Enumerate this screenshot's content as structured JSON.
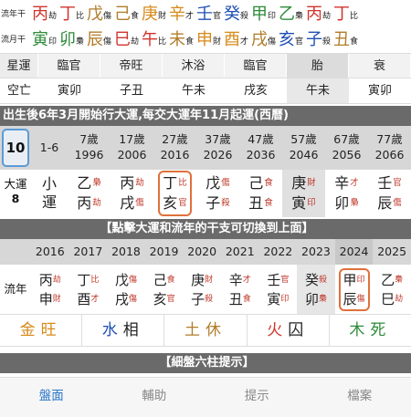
{
  "liunian_gz_row": {
    "label_top": "流年干",
    "label_bottom": "流月干",
    "pairs": [
      {
        "ch": "丙",
        "god": "劫",
        "color": "#d0342c"
      },
      {
        "ch": "丁",
        "god": "比",
        "color": "#d0342c"
      },
      {
        "ch": "戊",
        "god": "傷",
        "color": "#b07d2a"
      },
      {
        "ch": "己",
        "god": "食",
        "color": "#b07d2a"
      },
      {
        "ch": "庚",
        "god": "財",
        "color": "#d68a1a"
      },
      {
        "ch": "辛",
        "god": "才",
        "color": "#d68a1a"
      },
      {
        "ch": "壬",
        "god": "官",
        "color": "#1f4fb3"
      },
      {
        "ch": "癸",
        "god": "殺",
        "color": "#1f4fb3"
      },
      {
        "ch": "甲",
        "god": "印",
        "color": "#2e8b3a"
      },
      {
        "ch": "乙",
        "god": "梟",
        "color": "#2e8b3a"
      },
      {
        "ch": "丙",
        "god": "劫",
        "color": "#d0342c"
      },
      {
        "ch": "丁",
        "god": "比",
        "color": "#d0342c"
      }
    ]
  },
  "liuyue_gz_row": {
    "pairs": [
      {
        "ch": "寅",
        "god": "印",
        "color": "#2e8b3a"
      },
      {
        "ch": "卯",
        "god": "梟",
        "color": "#2e8b3a"
      },
      {
        "ch": "辰",
        "god": "傷",
        "color": "#b07d2a"
      },
      {
        "ch": "巳",
        "god": "劫",
        "color": "#d0342c"
      },
      {
        "ch": "午",
        "god": "比",
        "color": "#d0342c"
      },
      {
        "ch": "未",
        "god": "食",
        "color": "#b07d2a"
      },
      {
        "ch": "申",
        "god": "財",
        "color": "#d68a1a"
      },
      {
        "ch": "酉",
        "god": "才",
        "color": "#d68a1a"
      },
      {
        "ch": "戌",
        "god": "傷",
        "color": "#b07d2a"
      },
      {
        "ch": "亥",
        "god": "官",
        "color": "#1f4fb3"
      },
      {
        "ch": "子",
        "god": "殺",
        "color": "#1f4fb3"
      },
      {
        "ch": "丑",
        "god": "食",
        "color": "#b07d2a"
      }
    ]
  },
  "star_row": {
    "label": "星運",
    "cells": [
      "臨官",
      "帝旺",
      "沐浴",
      "臨官",
      "胎",
      "衰"
    ]
  },
  "kong_row": {
    "label": "空亡",
    "cells": [
      "寅卯",
      "子丑",
      "午未",
      "戌亥",
      "午未",
      "寅卯"
    ]
  },
  "dayun_banner": "出生後6年3月開始行大運,每交大運年11月起運(西曆)",
  "dayun": {
    "selected_number": "10",
    "first_age": "1-6",
    "label_top": "大運",
    "label_bottom": "8",
    "xiao_top": "小",
    "xiao_bottom": "運",
    "columns": [
      {
        "age": "7歲",
        "year": "1996",
        "gan": "乙",
        "gan_god": "梟",
        "zhi": "丙",
        "zhi_god": "劫"
      },
      {
        "age": "17歲",
        "year": "2006",
        "gan": "丙",
        "gan_god": "劫",
        "zhi": "戌",
        "zhi_god": "傷"
      },
      {
        "age": "27歲",
        "year": "2016",
        "gan": "丁",
        "gan_god": "比",
        "zhi": "亥",
        "zhi_god": "官"
      },
      {
        "age": "37歲",
        "year": "2026",
        "gan": "戊",
        "gan_god": "傷",
        "zhi": "子",
        "zhi_god": "殺"
      },
      {
        "age": "47歲",
        "year": "2036",
        "gan": "己",
        "gan_god": "食",
        "zhi": "丑",
        "zhi_god": "食"
      },
      {
        "age": "57歲",
        "year": "2046",
        "gan": "庚",
        "gan_god": "財",
        "zhi": "寅",
        "zhi_god": "印"
      },
      {
        "age": "67歲",
        "year": "2056",
        "gan": "辛",
        "gan_god": "才",
        "zhi": "卯",
        "zhi_god": "梟"
      },
      {
        "age": "77歲",
        "year": "2066",
        "gan": "壬",
        "gan_god": "官",
        "zhi": "辰",
        "zhi_god": "傷"
      }
    ]
  },
  "click_banner": "【點擊大運和流年的干支可切換到上面】",
  "liunian": {
    "label": "流年",
    "columns": [
      {
        "year": "2016",
        "gan": "丙",
        "gan_god": "劫",
        "zhi": "申",
        "zhi_god": "財"
      },
      {
        "year": "2017",
        "gan": "丁",
        "gan_god": "比",
        "zhi": "酉",
        "zhi_god": "才"
      },
      {
        "year": "2018",
        "gan": "戊",
        "gan_god": "傷",
        "zhi": "戌",
        "zhi_god": "傷"
      },
      {
        "year": "2019",
        "gan": "己",
        "gan_god": "食",
        "zhi": "亥",
        "zhi_god": "官"
      },
      {
        "year": "2020",
        "gan": "庚",
        "gan_god": "財",
        "zhi": "子",
        "zhi_god": "殺"
      },
      {
        "year": "2021",
        "gan": "辛",
        "gan_god": "才",
        "zhi": "丑",
        "zhi_god": "食"
      },
      {
        "year": "2022",
        "gan": "壬",
        "gan_god": "官",
        "zhi": "寅",
        "zhi_god": "印"
      },
      {
        "year": "2023",
        "gan": "癸",
        "gan_god": "殺",
        "zhi": "卯",
        "zhi_god": "梟"
      },
      {
        "year": "2024",
        "gan": "甲",
        "gan_god": "印",
        "zhi": "辰",
        "zhi_god": "傷"
      },
      {
        "year": "2025",
        "gan": "乙",
        "gan_god": "梟",
        "zhi": "巳",
        "zhi_god": "劫"
      }
    ]
  },
  "wuxing": [
    {
      "element": "金",
      "state": "旺",
      "color": "#d68a1a"
    },
    {
      "element": "水",
      "state": "相",
      "color": "#1f4fb3"
    },
    {
      "element": "土",
      "state": "休",
      "color": "#b07d2a"
    },
    {
      "element": "火",
      "state": "囚",
      "color": "#d0342c"
    },
    {
      "element": "木",
      "state": "死",
      "color": "#2e8b3a"
    }
  ],
  "six_pillar_banner": "【細盤六柱提示】",
  "tabs": [
    {
      "label": "盤面",
      "active": true
    },
    {
      "label": "輔助",
      "active": false
    },
    {
      "label": "提示",
      "active": false
    },
    {
      "label": "檔案",
      "active": false
    }
  ],
  "colors": {
    "accent": "#2a77c9",
    "selection": "#e0703a",
    "banner": "#6a6a6a"
  }
}
